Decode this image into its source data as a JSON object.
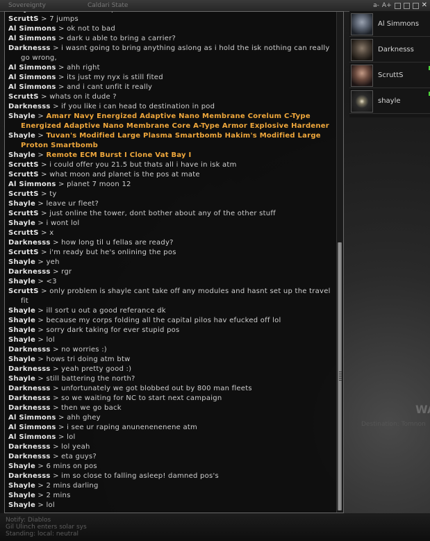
{
  "topbar": {
    "left_text": "Sovereignty",
    "mid_text": "Caldari State",
    "font_dec": "a-",
    "font_inc": "A+"
  },
  "background": {
    "hint1": "WA",
    "hint2": "Destination: Tomnon",
    "bottom_lines": [
      "Notify: Diablos",
      "Gil Ulinch enters solar sys",
      "Standing: local: neutral"
    ]
  },
  "members": [
    {
      "name": "Al Simmons",
      "online": false,
      "portrait": "pilot-portrait-1"
    },
    {
      "name": "Darknesss",
      "online": false,
      "portrait": "pilot-portrait-2"
    },
    {
      "name": "ScruttS",
      "online": true,
      "portrait": "pilot-portrait-3"
    },
    {
      "name": "shayle",
      "online": true,
      "portrait": "pilot-portrait-4"
    }
  ],
  "messages": [
    {
      "sender": "Shayle",
      "text": "eta on those isalopes?"
    },
    {
      "sender": "ScruttS",
      "text": "7 jumps"
    },
    {
      "sender": "Al Simmons",
      "text": "ok not to bad"
    },
    {
      "sender": "Al Simmons",
      "text": "dark u able to bring a carrier?"
    },
    {
      "sender": "Darknesss",
      "text": "i wasnt going to bring anything aslong as i hold the isk nothing can really go wrong,"
    },
    {
      "sender": "Al Simmons",
      "text": "ahh right"
    },
    {
      "sender": "Al Simmons",
      "text": "its just my nyx is still fited"
    },
    {
      "sender": "Al Simmons",
      "text": "and i cant unfit it really"
    },
    {
      "sender": "ScruttS",
      "text": "whats on it dude ?"
    },
    {
      "sender": "Darknesss",
      "text": "if you like i can head to destination in pod"
    },
    {
      "sender": "Shayle",
      "text": "Amarr Navy Energized Adaptive Nano Membrane Corelum C-Type Energized Adaptive Nano Membrane Core A-Type Armor Explosive Hardener",
      "link": true
    },
    {
      "sender": "Shayle",
      "text": "Tuvan's Modified Large Plasma Smartbomb Hakim's Modified Large Proton Smartbomb",
      "link": true
    },
    {
      "sender": "Shayle",
      "text": "Remote ECM Burst I Clone Vat Bay I",
      "link": true
    },
    {
      "sender": "ScruttS",
      "text": "i could offer you 21.5 but thats all i have in isk atm"
    },
    {
      "sender": "ScruttS",
      "text": "what moon and planet is the pos at mate"
    },
    {
      "sender": "Al Simmons",
      "text": "planet 7 moon 12"
    },
    {
      "sender": "ScruttS",
      "text": "ty"
    },
    {
      "sender": "Shayle",
      "text": "leave ur fleet?"
    },
    {
      "sender": "ScruttS",
      "text": "just online the tower, dont bother about any of the other stuff"
    },
    {
      "sender": "Shayle",
      "text": "i wont lol"
    },
    {
      "sender": "ScruttS",
      "text": "x"
    },
    {
      "sender": "Darknesss",
      "text": "how long til u fellas are ready?"
    },
    {
      "sender": "ScruttS",
      "text": "i'm ready but he's onlining the pos"
    },
    {
      "sender": "Shayle",
      "text": "yeh"
    },
    {
      "sender": "Darknesss",
      "text": "rgr"
    },
    {
      "sender": "Shayle",
      "text": "<3"
    },
    {
      "sender": "ScruttS",
      "text": "only problem is shayle cant take off any modules and hasnt set up the travel fit"
    },
    {
      "sender": "Shayle",
      "text": "ill sort u out a good referance dk"
    },
    {
      "sender": "Shayle",
      "text": "because my corps folding all the capital pilos hav efucked off lol"
    },
    {
      "sender": "Shayle",
      "text": "sorry dark taking for ever stupid pos"
    },
    {
      "sender": "Shayle",
      "text": "lol"
    },
    {
      "sender": "Darknesss",
      "text": "no worries :)"
    },
    {
      "sender": "Shayle",
      "text": "hows tri doing atm btw"
    },
    {
      "sender": "Darknesss",
      "text": "yeah pretty good :)"
    },
    {
      "sender": "Shayle",
      "text": "still battering the north?"
    },
    {
      "sender": "Darknesss",
      "text": "unfortunately we got blobbed out by 800 man fleets"
    },
    {
      "sender": "Darknesss",
      "text": "so we waiting for NC to start next campaign"
    },
    {
      "sender": "Darknesss",
      "text": "then we go back"
    },
    {
      "sender": "Al Simmons",
      "text": "ahh ghey"
    },
    {
      "sender": "Al Simmons",
      "text": "i see ur raping anunenenenene atm"
    },
    {
      "sender": "Al Simmons",
      "text": "lol"
    },
    {
      "sender": "Darknesss",
      "text": "lol yeah"
    },
    {
      "sender": "Darknesss",
      "text": "eta guys?"
    },
    {
      "sender": "Shayle",
      "text": "6 mins on pos"
    },
    {
      "sender": "Darknesss",
      "text": "im so close to falling asleep! damned pos's"
    },
    {
      "sender": "Shayle",
      "text": "2 mins darling"
    },
    {
      "sender": "Shayle",
      "text": "2 mins"
    },
    {
      "sender": "Shayle",
      "text": "lol"
    }
  ],
  "scroll": {
    "thumb_fraction_start": 0.46,
    "thumb_fraction_size": 0.535
  },
  "colors": {
    "link": "#f0a83c",
    "online": "#4ccf3a"
  }
}
